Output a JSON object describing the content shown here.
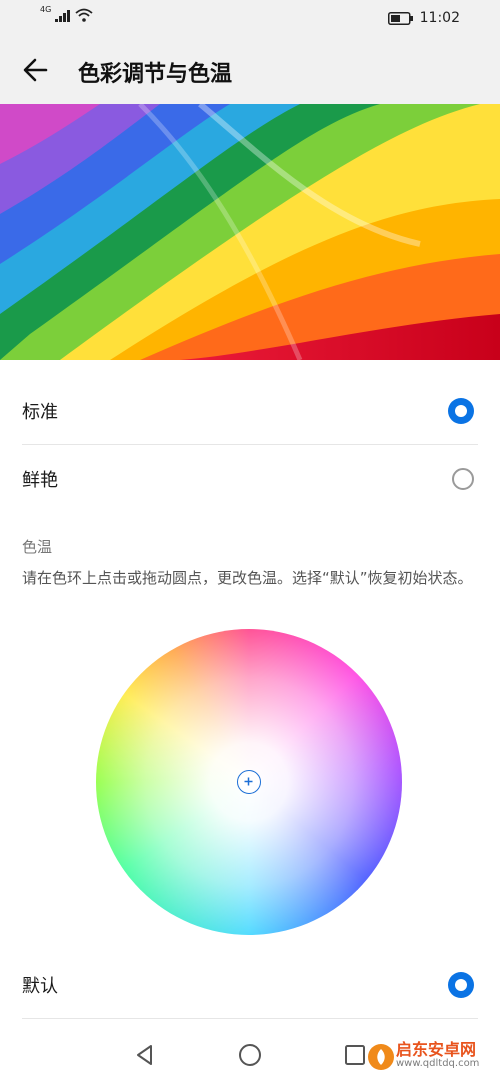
{
  "status_bar": {
    "network": "4G",
    "time": "11:02"
  },
  "header": {
    "title": "色彩调节与色温"
  },
  "color_modes": [
    {
      "label": "标准",
      "selected": true
    },
    {
      "label": "鲜艳",
      "selected": false
    }
  ],
  "color_temperature": {
    "section_label": "色温",
    "description": "请在色环上点击或拖动圆点，更改色温。选择“默认”恢复初始状态。"
  },
  "temperature_presets": [
    {
      "label": "默认",
      "selected": true
    }
  ],
  "watermark": {
    "text": "启东安卓网",
    "url": "www.qdltdq.com"
  },
  "colors": {
    "accent": "#0a73e4",
    "bar_background": "#f1f1f1"
  },
  "icons": [
    "wifi-icon",
    "signal-icon",
    "battery-icon",
    "back-arrow-icon",
    "nav-back-icon",
    "nav-home-icon",
    "nav-recents-icon"
  ]
}
